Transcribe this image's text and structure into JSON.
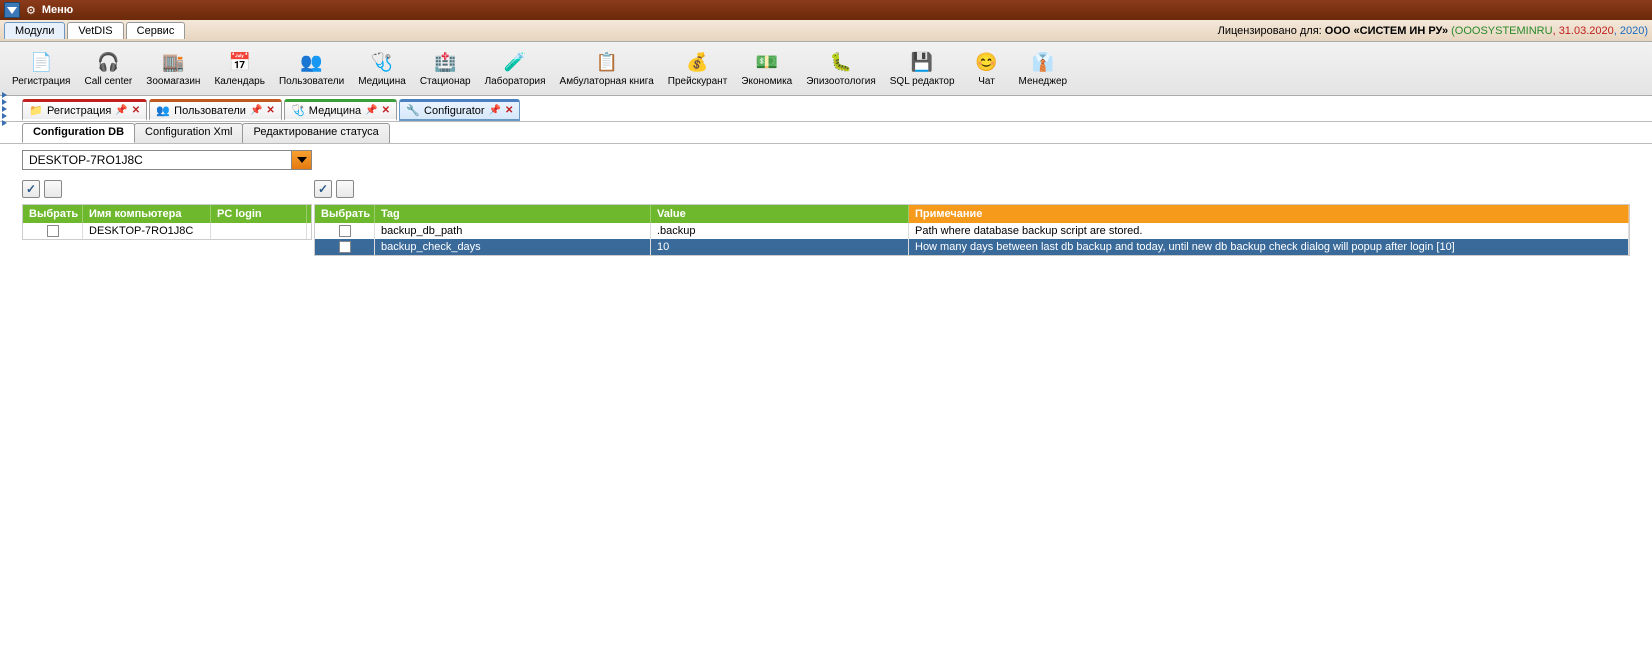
{
  "title": "Меню",
  "menu_tabs": [
    "Модули",
    "VetDIS",
    "Сервис"
  ],
  "active_menu_tab": 0,
  "license": {
    "prefix": "Лицензировано для: ",
    "company": "ООО «СИСТЕМ ИН РУ» ",
    "code": "(OOOSYSTEMINRU",
    "date": ", 31.03.2020",
    "year": ", 2020)"
  },
  "toolbar": [
    {
      "icon": "📄",
      "label": "Регистрация"
    },
    {
      "icon": "🎧",
      "label": "Call center"
    },
    {
      "icon": "🏬",
      "label": "Зоомагазин"
    },
    {
      "icon": "📅",
      "label": "Календарь"
    },
    {
      "icon": "👥",
      "label": "Пользователи"
    },
    {
      "icon": "🩺",
      "label": "Медицина"
    },
    {
      "icon": "🏥",
      "label": "Стационар"
    },
    {
      "icon": "🧪",
      "label": "Лаборатория"
    },
    {
      "icon": "📋",
      "label": "Амбулаторная книга"
    },
    {
      "icon": "💰",
      "label": "Прейскурант"
    },
    {
      "icon": "💵",
      "label": "Экономика"
    },
    {
      "icon": "🐛",
      "label": "Эпизоотология"
    },
    {
      "icon": "💾",
      "label": "SQL редактор"
    },
    {
      "icon": "😊",
      "label": "Чат"
    },
    {
      "icon": "👔",
      "label": "Менеджер"
    }
  ],
  "doc_tabs": [
    {
      "label": "Регистрация",
      "cls": "c-reg",
      "icon": "📁"
    },
    {
      "label": "Пользователи",
      "cls": "c-usr",
      "icon": "👥"
    },
    {
      "label": "Медицина",
      "cls": "c-med",
      "icon": "🩺"
    },
    {
      "label": "Configurator",
      "cls": "c-conf",
      "icon": "🔧",
      "active": true
    }
  ],
  "sub_tabs": [
    "Configuration DB",
    "Configuration Xml",
    "Редактирование статуса"
  ],
  "active_sub": 0,
  "combo_value": "DESKTOP-7RO1J8C",
  "left_headers": [
    "Выбрать",
    "Имя компьютера",
    "PC login"
  ],
  "left_rows": [
    {
      "sel": false,
      "comp": "DESKTOP-7RO1J8C",
      "login": ""
    }
  ],
  "right_headers": [
    "Выбрать",
    "Tag",
    "Value",
    "Примечание"
  ],
  "right_rows": [
    {
      "sel": false,
      "tag": "backup_db_path",
      "value": ".backup",
      "note": "Path where database backup script are stored.",
      "selrow": false
    },
    {
      "sel": false,
      "tag": "backup_check_days",
      "value": "10",
      "note": "How many days between last db backup and today, until new db backup check dialog will popup after login [10]",
      "selrow": true
    }
  ]
}
